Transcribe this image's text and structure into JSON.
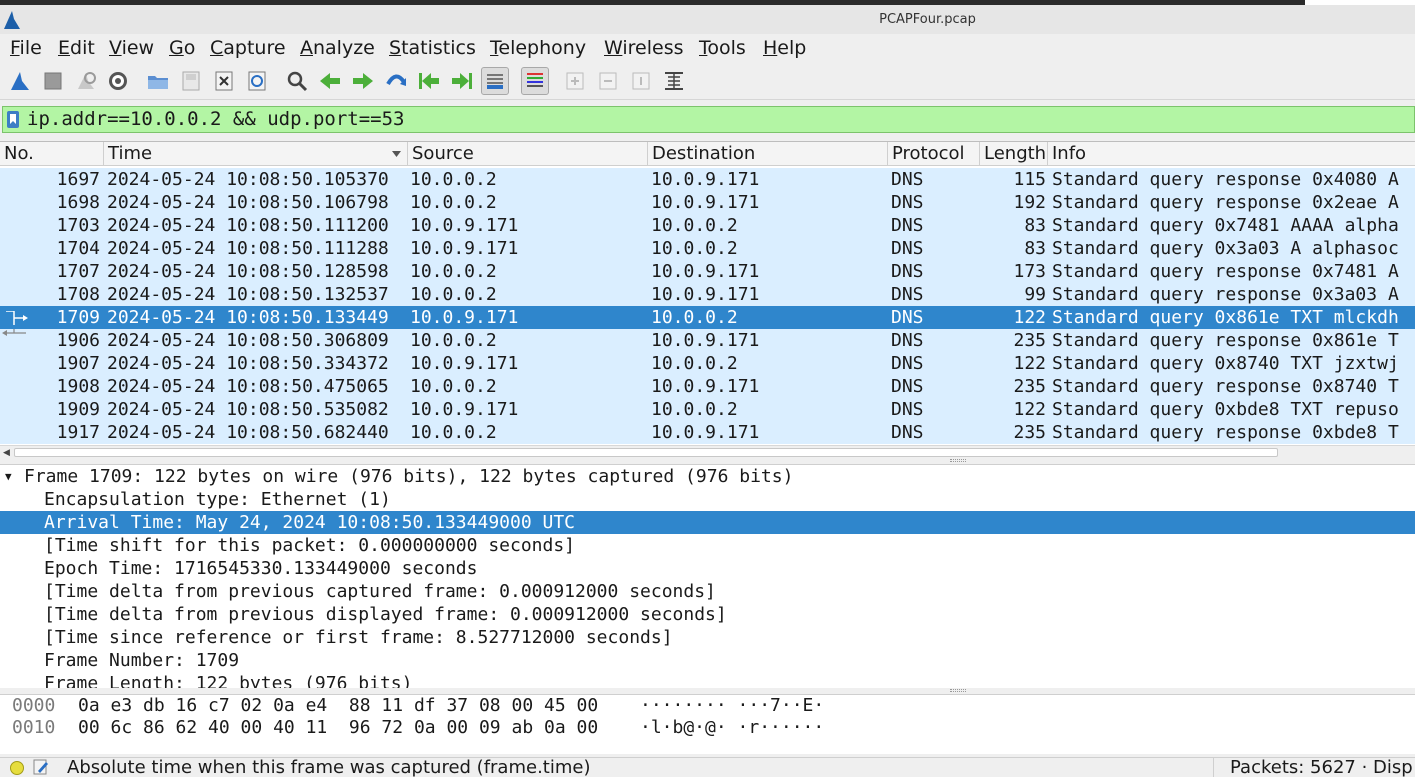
{
  "window": {
    "title": "PCAPFour.pcap"
  },
  "menu": [
    "File",
    "Edit",
    "View",
    "Go",
    "Capture",
    "Analyze",
    "Statistics",
    "Telephony",
    "Wireless",
    "Tools",
    "Help"
  ],
  "toolbar_icons": [
    "shark-fin-icon",
    "stop-icon",
    "restart-icon",
    "options-gear-icon",
    "open-folder-icon",
    "save-file-icon",
    "close-file-icon",
    "reload-icon",
    "find-icon",
    "back-arrow-icon",
    "forward-arrow-icon",
    "go-to-packet-icon",
    "first-packet-icon",
    "last-packet-icon",
    "autoscroll-icon",
    "colorize-icon",
    "zoom-in-icon",
    "zoom-out-icon",
    "normal-size-icon",
    "resize-columns-icon"
  ],
  "filter": {
    "text": "ip.addr==10.0.0.2 && udp.port==53"
  },
  "columns": [
    "No.",
    "Time",
    "Source",
    "Destination",
    "Protocol",
    "Length",
    "Info"
  ],
  "packets": [
    {
      "no": "1697",
      "time": "2024-05-24 10:08:50.105370",
      "src": "10.0.0.2",
      "dst": "10.0.9.171",
      "proto": "DNS",
      "len": "115",
      "info": "Standard query response 0x4080 A"
    },
    {
      "no": "1698",
      "time": "2024-05-24 10:08:50.106798",
      "src": "10.0.0.2",
      "dst": "10.0.9.171",
      "proto": "DNS",
      "len": "192",
      "info": "Standard query response 0x2eae A"
    },
    {
      "no": "1703",
      "time": "2024-05-24 10:08:50.111200",
      "src": "10.0.9.171",
      "dst": "10.0.0.2",
      "proto": "DNS",
      "len": "83",
      "info": "Standard query 0x7481 AAAA alpha"
    },
    {
      "no": "1704",
      "time": "2024-05-24 10:08:50.111288",
      "src": "10.0.9.171",
      "dst": "10.0.0.2",
      "proto": "DNS",
      "len": "83",
      "info": "Standard query 0x3a03 A alphasoc"
    },
    {
      "no": "1707",
      "time": "2024-05-24 10:08:50.128598",
      "src": "10.0.0.2",
      "dst": "10.0.9.171",
      "proto": "DNS",
      "len": "173",
      "info": "Standard query response 0x7481 A"
    },
    {
      "no": "1708",
      "time": "2024-05-24 10:08:50.132537",
      "src": "10.0.0.2",
      "dst": "10.0.9.171",
      "proto": "DNS",
      "len": "99",
      "info": "Standard query response 0x3a03 A"
    },
    {
      "no": "1709",
      "time": "2024-05-24 10:08:50.133449",
      "src": "10.0.9.171",
      "dst": "10.0.0.2",
      "proto": "DNS",
      "len": "122",
      "info": "Standard query 0x861e TXT mlckdh"
    },
    {
      "no": "1906",
      "time": "2024-05-24 10:08:50.306809",
      "src": "10.0.0.2",
      "dst": "10.0.9.171",
      "proto": "DNS",
      "len": "235",
      "info": "Standard query response 0x861e T"
    },
    {
      "no": "1907",
      "time": "2024-05-24 10:08:50.334372",
      "src": "10.0.9.171",
      "dst": "10.0.0.2",
      "proto": "DNS",
      "len": "122",
      "info": "Standard query 0x8740 TXT jzxtwj"
    },
    {
      "no": "1908",
      "time": "2024-05-24 10:08:50.475065",
      "src": "10.0.0.2",
      "dst": "10.0.9.171",
      "proto": "DNS",
      "len": "235",
      "info": "Standard query response 0x8740 T"
    },
    {
      "no": "1909",
      "time": "2024-05-24 10:08:50.535082",
      "src": "10.0.9.171",
      "dst": "10.0.0.2",
      "proto": "DNS",
      "len": "122",
      "info": "Standard query 0xbde8 TXT repuso"
    },
    {
      "no": "1917",
      "time": "2024-05-24 10:08:50.682440",
      "src": "10.0.0.2",
      "dst": "10.0.9.171",
      "proto": "DNS",
      "len": "235",
      "info": "Standard query response 0xbde8 T"
    }
  ],
  "selected_packet": "1709",
  "details": [
    "Frame 1709: 122 bytes on wire (976 bits), 122 bytes captured (976 bits)",
    "Encapsulation type: Ethernet (1)",
    "Arrival Time: May 24, 2024 10:08:50.133449000 UTC",
    "[Time shift for this packet: 0.000000000 seconds]",
    "Epoch Time: 1716545330.133449000 seconds",
    "[Time delta from previous captured frame: 0.000912000 seconds]",
    "[Time delta from previous displayed frame: 0.000912000 seconds]",
    "[Time since reference or first frame: 8.527712000 seconds]",
    "Frame Number: 1709",
    "Frame Length: 122 bytes (976 bits)"
  ],
  "bytes": [
    {
      "offset": "0000",
      "hex": "0a e3 db 16 c7 02 0a e4  88 11 df 37 08 00 45 00",
      "ascii": "········ ···7··E·"
    },
    {
      "offset": "0010",
      "hex": "00 6c 86 62 40 00 40 11  96 72 0a 00 09 ab 0a 00",
      "ascii": "·l·b@·@· ·r······"
    }
  ],
  "status": {
    "message": "Absolute time when this frame was captured (frame.time)",
    "packets": "Packets: 5627 · Disp"
  },
  "colors": {
    "selection": "#2f86cc",
    "row_bg": "#daeeff",
    "filter_bg": "#b3f5a4"
  }
}
